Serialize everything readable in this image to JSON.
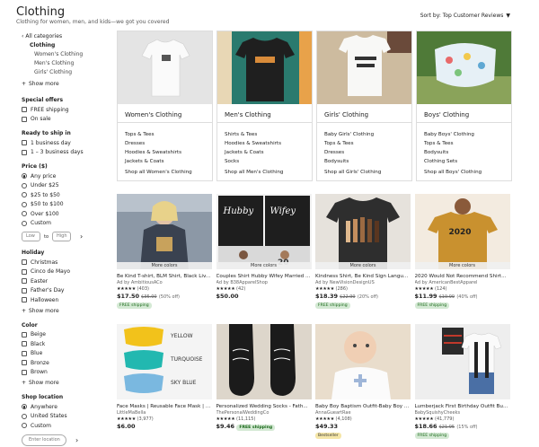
{
  "header": {
    "title": "Clothing",
    "subtitle": "Clothing for women, men, and kids—we got you covered",
    "sort_label": "Sort by: Top Customer Reviews",
    "sort_caret": "▼"
  },
  "sidebar": {
    "all_categories": "All categories",
    "current": "Clothing",
    "subcategories": [
      "Women's Clothing",
      "Men's Clothing",
      "Girls' Clothing"
    ],
    "show_more": "Show more",
    "special_offers": {
      "title": "Special offers",
      "options": [
        "FREE shipping",
        "On sale"
      ]
    },
    "ready_to_ship": {
      "title": "Ready to ship in",
      "options": [
        "1 business day",
        "1 – 3 business days"
      ]
    },
    "price": {
      "title": "Price ($)",
      "options": [
        "Any price",
        "Under $25",
        "$25 to $50",
        "$50 to $100",
        "Over $100",
        "Custom"
      ],
      "selected": "Any price",
      "low_placeholder": "Low",
      "to": "to",
      "high_placeholder": "High"
    },
    "holiday": {
      "title": "Holiday",
      "options": [
        "Christmas",
        "Cinco de Mayo",
        "Easter",
        "Father's Day",
        "Halloween"
      ]
    },
    "color": {
      "title": "Color",
      "options": [
        "Beige",
        "Black",
        "Blue",
        "Bronze",
        "Brown"
      ]
    },
    "shop_location": {
      "title": "Shop location",
      "options": [
        "Anywhere",
        "United States",
        "Custom"
      ],
      "selected": "Anywhere",
      "placeholder": "Enter location"
    },
    "arrow": "›"
  },
  "categories": [
    {
      "name": "Women's Clothing",
      "links": [
        "Tops & Tees",
        "Dresses",
        "Hoodies & Sweatshirts",
        "Jackets & Coats"
      ],
      "shop_all": "Shop all Women's Clothing",
      "image_bg": "#dcdcdc"
    },
    {
      "name": "Men's Clothing",
      "links": [
        "Shirts & Tees",
        "Hoodies & Sweatshirts",
        "Jackets & Coats",
        "Socks"
      ],
      "shop_all": "Shop all Men's Clothing",
      "image_bg": "#2a7a6e"
    },
    {
      "name": "Girls' Clothing",
      "links": [
        "Baby Girls' Clothing",
        "Tops & Tees",
        "Dresses",
        "Bodysuits"
      ],
      "shop_all": "Shop all Girls' Clothing",
      "image_bg": "#d9c7b0"
    },
    {
      "name": "Boys' Clothing",
      "links": [
        "Baby Boys' Clothing",
        "Tops & Tees",
        "Bodysuits",
        "Clothing Sets"
      ],
      "shop_all": "Shop all Boys' Clothing",
      "image_bg": "#4f7a38"
    }
  ],
  "listings": [
    {
      "title": "Be Kind T-shirt, BLM Shirt, Black Liv...",
      "seller": "Ad by AmbitiousACo",
      "stars": "★★★★★",
      "count": "(403)",
      "price": "$17.50",
      "old_price": "$35.00",
      "discount": "(50% off)",
      "more_colors": "More colors",
      "badge": "FREE shipping",
      "image_bg": "#7d8a9a"
    },
    {
      "title": "Couples Shirt Hubby Wifey Married ...",
      "seller": "Ad by B38ApparelShop",
      "stars": "★★★★★",
      "count": "(42)",
      "price": "$50.00",
      "old_price": "",
      "discount": "",
      "more_colors": "More colors",
      "badge": "",
      "image_bg": "#1e1e1e",
      "caption_left": "Hubby",
      "caption_right": "Wifey"
    },
    {
      "title": "Kindness Shirt, Be Kind Sign Langu...",
      "seller": "Ad by NewVisionDesignUS",
      "stars": "★★★★★",
      "count": "(286)",
      "price": "$18.39",
      "old_price": "$22.99",
      "discount": "(20% off)",
      "more_colors": "More colors",
      "badge": "FREE shipping",
      "image_bg": "#333333"
    },
    {
      "title": "2020 Would Not Recommend Shirt...",
      "seller": "Ad by AmericanBestApparel",
      "stars": "★★★★★",
      "count": "(124)",
      "price": "$11.99",
      "old_price": "$19.99",
      "discount": "(40% off)",
      "more_colors": "More colors",
      "badge": "FREE shipping",
      "image_bg": "#c48a2e",
      "caption": "2020"
    },
    {
      "title": "Face Masks | Reusable Face Mask | F...",
      "seller": "LittleMaBella",
      "stars": "★★★★★",
      "count": "(3,977)",
      "price": "$6.00",
      "old_price": "",
      "discount": "",
      "more_colors": "",
      "badge": "",
      "image_bg": "#f4f4f4",
      "mask_labels": [
        "YELLOW",
        "TURQUOISE",
        "SKY BLUE"
      ]
    },
    {
      "title": "Personalized Wedding Socks - Fath...",
      "seller": "ThePersonalWeddingCo",
      "stars": "★★★★★",
      "count": "(11,115)",
      "price": "$9.46",
      "old_price": "",
      "discount": "",
      "more_colors": "",
      "badge": "FREE shipping",
      "image_bg": "#dcd6cc"
    },
    {
      "title": "Baby Boy Baptism Outfit-Baby Boy ...",
      "seller": "AnnaGueartRae",
      "stars": "★★★★★",
      "count": "(4,108)",
      "price": "$49.33",
      "old_price": "",
      "discount": "",
      "more_colors": "",
      "badge": "",
      "bestseller": "Bestseller",
      "image_bg": "#e8dccb"
    },
    {
      "title": "Lumberjack First Birthday Outfit Bu...",
      "seller": "BabySquishyCheeks",
      "stars": "★★★★★",
      "count": "(41,779)",
      "price": "$18.66",
      "old_price": "$21.95",
      "discount": "(15% off)",
      "more_colors": "",
      "badge": "FREE shipping",
      "image_bg": "#ececec"
    }
  ]
}
